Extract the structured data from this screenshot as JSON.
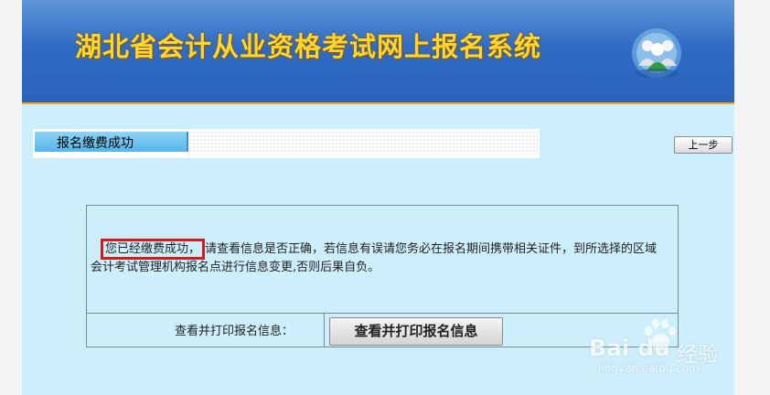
{
  "header": {
    "title": "湖北省会计从业资格考试网上报名系统"
  },
  "tab": {
    "label": "报名缴费成功"
  },
  "toolbar": {
    "prev_label": "上一步"
  },
  "message": {
    "highlighted": "您已经缴费成功，",
    "body": "请查看信息是否正确，若信息有误请您务必在报名期间携带相关证件，到所选择的区域会计考试管理机构报名点进行信息变更,否则后果自负。"
  },
  "print_row": {
    "label": "查看并打印报名信息：",
    "button_label": "查看并打印报名信息"
  },
  "watermark": {
    "brand": "Bai du",
    "jingyan": "经验",
    "url": "jingyan.baidu.com"
  },
  "colors": {
    "banner_blue": "#2f6bc4",
    "title_yellow": "#ffd52e",
    "page_bg": "#cdeefb",
    "highlight_red": "#d11c1c",
    "accent_orange": "#f0a418"
  }
}
